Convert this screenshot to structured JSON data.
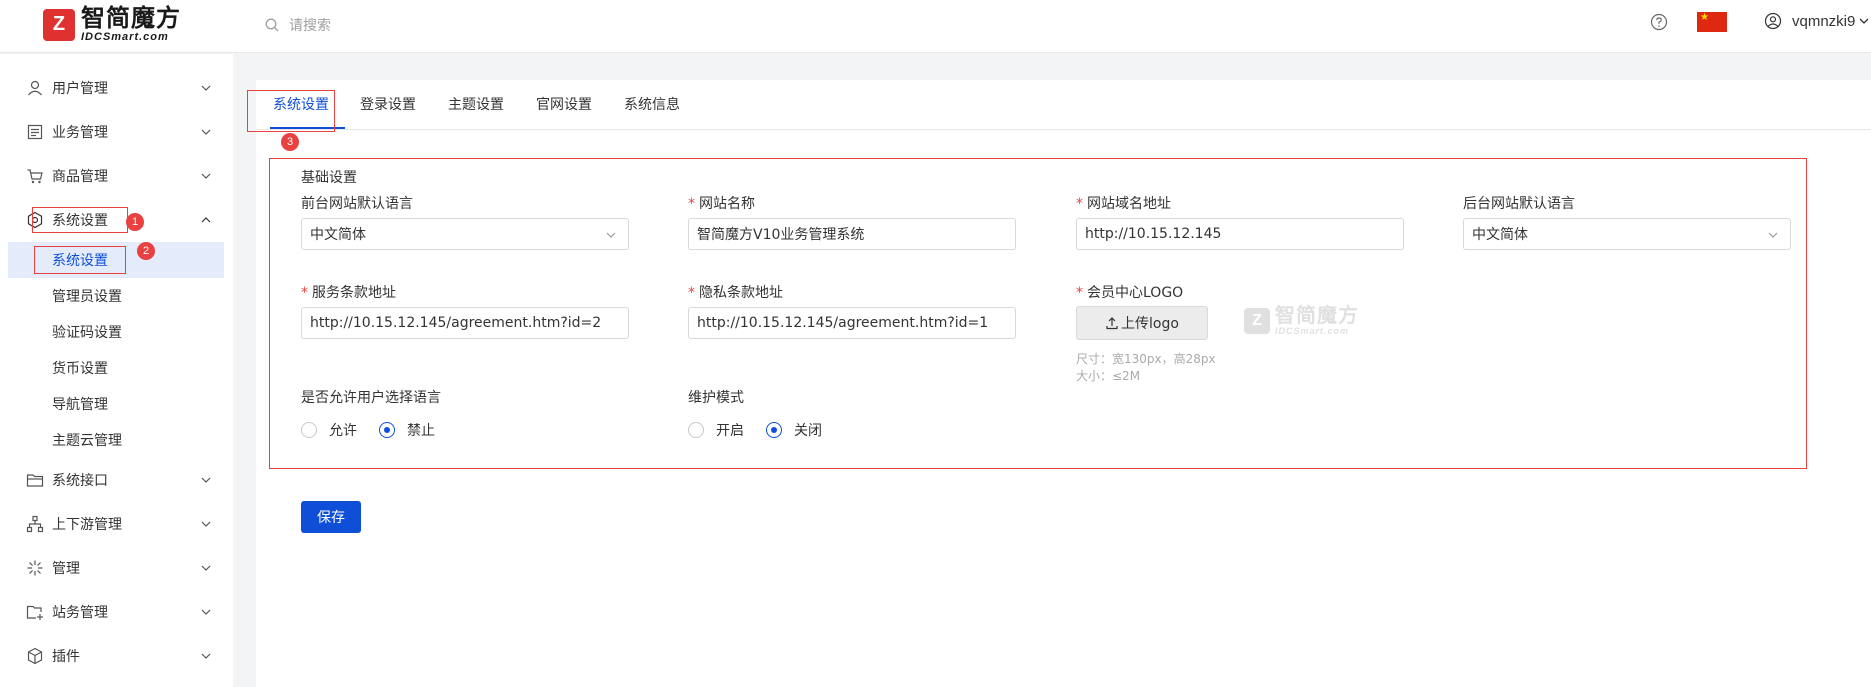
{
  "header": {
    "logo_cn": "智简魔方",
    "logo_en": "IDCSmart.com",
    "search_placeholder": "请搜索",
    "username": "vqmnzki9"
  },
  "sidebar": {
    "items": [
      {
        "label": "用户管理",
        "icon": "user-icon"
      },
      {
        "label": "业务管理",
        "icon": "document-icon"
      },
      {
        "label": "商品管理",
        "icon": "cart-icon"
      },
      {
        "label": "系统设置",
        "icon": "settings-icon"
      },
      {
        "label": "系统接口",
        "icon": "folder-icon"
      },
      {
        "label": "上下游管理",
        "icon": "hierarchy-icon"
      },
      {
        "label": "管理",
        "icon": "sparkle-icon"
      },
      {
        "label": "站务管理",
        "icon": "folder-plus-icon"
      },
      {
        "label": "插件",
        "icon": "cube-icon"
      }
    ],
    "subitems": [
      {
        "label": "系统设置"
      },
      {
        "label": "管理员设置"
      },
      {
        "label": "验证码设置"
      },
      {
        "label": "货币设置"
      },
      {
        "label": "导航管理"
      },
      {
        "label": "主题云管理"
      }
    ]
  },
  "annotations": {
    "step1": "1",
    "step2": "2",
    "step3": "3"
  },
  "tabs": [
    {
      "label": "系统设置",
      "active": true
    },
    {
      "label": "登录设置"
    },
    {
      "label": "主题设置"
    },
    {
      "label": "官网设置"
    },
    {
      "label": "系统信息"
    }
  ],
  "form": {
    "section_title": "基础设置",
    "front_lang_label": "前台网站默认语言",
    "front_lang_value": "中文简体",
    "site_name_label": "网站名称",
    "site_name_value": "智简魔方V10业务管理系统",
    "domain_label": "网站域名地址",
    "domain_value": "http://10.15.12.145",
    "admin_lang_label": "后台网站默认语言",
    "admin_lang_value": "中文简体",
    "terms_label": "服务条款地址",
    "terms_value": "http://10.15.12.145/agreement.htm?id=2",
    "privacy_label": "隐私条款地址",
    "privacy_value": "http://10.15.12.145/agreement.htm?id=1",
    "logo_label": "会员中心LOGO",
    "upload_label": "上传logo",
    "logo_hint_size": "尺寸：宽130px，高28px",
    "logo_hint_max": "大小：≤2M",
    "allow_lang_label": "是否允许用户选择语言",
    "allow_opt": "允许",
    "deny_opt": "禁止",
    "maintenance_label": "维护模式",
    "on_opt": "开启",
    "off_opt": "关闭",
    "required_mark": "*",
    "save_label": "保存"
  },
  "colors": {
    "accent": "#0f4fd8",
    "annotation_red": "#e94040"
  }
}
